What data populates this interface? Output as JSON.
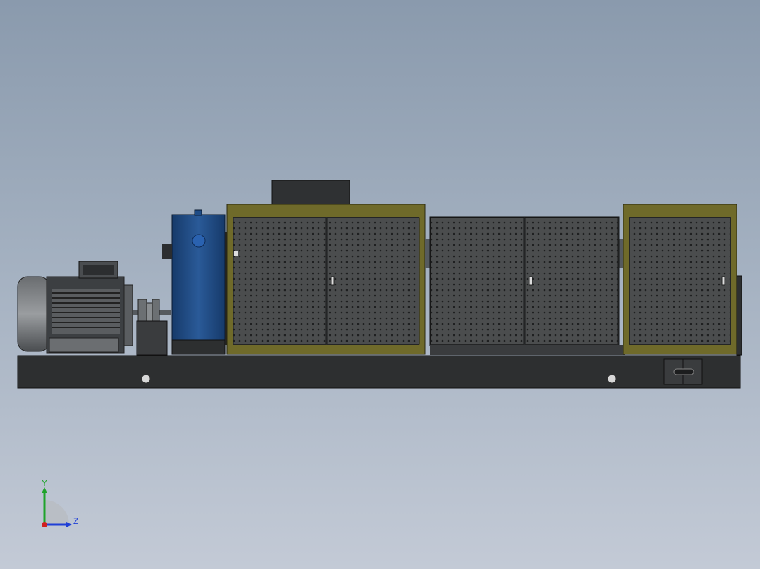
{
  "viewport": {
    "background_top": "#8a9aad",
    "background_bottom": "#c3cad6"
  },
  "model": {
    "colors": {
      "base_frame": "#2d2f30",
      "cabinet_panel": "#4b4d4e",
      "cabinet_trim": "#6f6a2a",
      "gearbox_body": "#1f4c86",
      "motor_body": "#3c3f42",
      "motor_fins": "#5a5d60",
      "perforation": "#1e1f20",
      "shaft": "#555a5f"
    },
    "icons": {
      "motor": "electric-motor-icon",
      "gearbox": "gearbox-icon",
      "coupling": "coupling-icon"
    }
  },
  "triad": {
    "y_label": "Y",
    "z_label": "Z",
    "colors": {
      "y": "#1fa32a",
      "z": "#1f3fd6",
      "x": "#d02020"
    }
  }
}
